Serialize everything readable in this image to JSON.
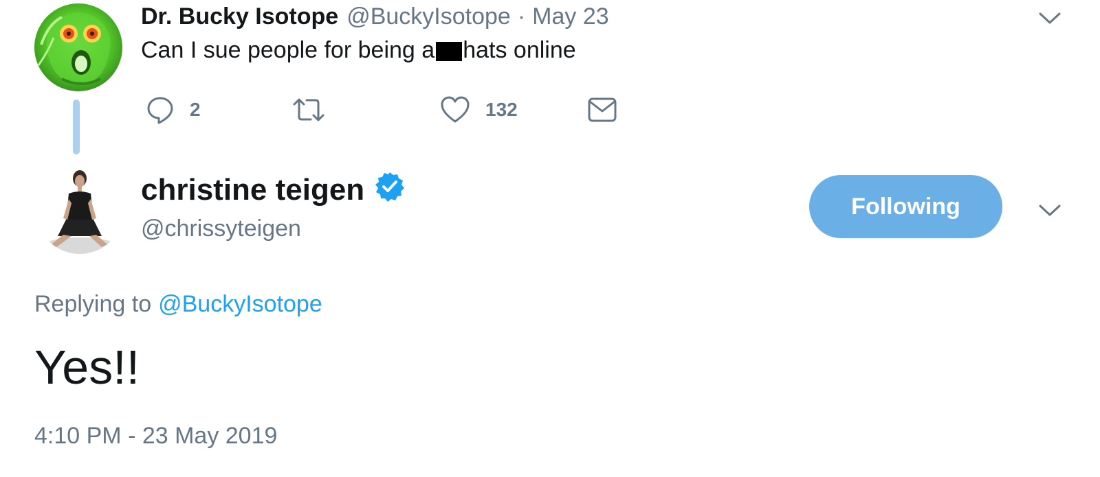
{
  "parent_tweet": {
    "author_name": "Dr. Bucky Isotope",
    "handle": "@BuckyIsotope",
    "separator": "·",
    "date": "May 23",
    "text_before": "Can I sue people for being a",
    "text_after": "hats online",
    "actions": {
      "reply_count": "2",
      "retweet_count": "",
      "like_count": "132"
    },
    "icons": [
      "reply-icon",
      "retweet-icon",
      "heart-icon",
      "envelope-icon",
      "chevron-down-icon"
    ]
  },
  "main_tweet": {
    "author_name": "christine teigen",
    "verified": true,
    "handle": "@chrissyteigen",
    "follow_label": "Following",
    "replying_prefix": "Replying to",
    "replying_to": "@BuckyIsotope",
    "text": "Yes!!",
    "timestamp": "4:10 PM - 23 May 2019"
  },
  "colors": {
    "accent": "#1da1f2",
    "following_button": "#6aafe6",
    "secondary_text": "#657786",
    "thread_line": "#aad0ee",
    "primary_text": "#14171a"
  }
}
